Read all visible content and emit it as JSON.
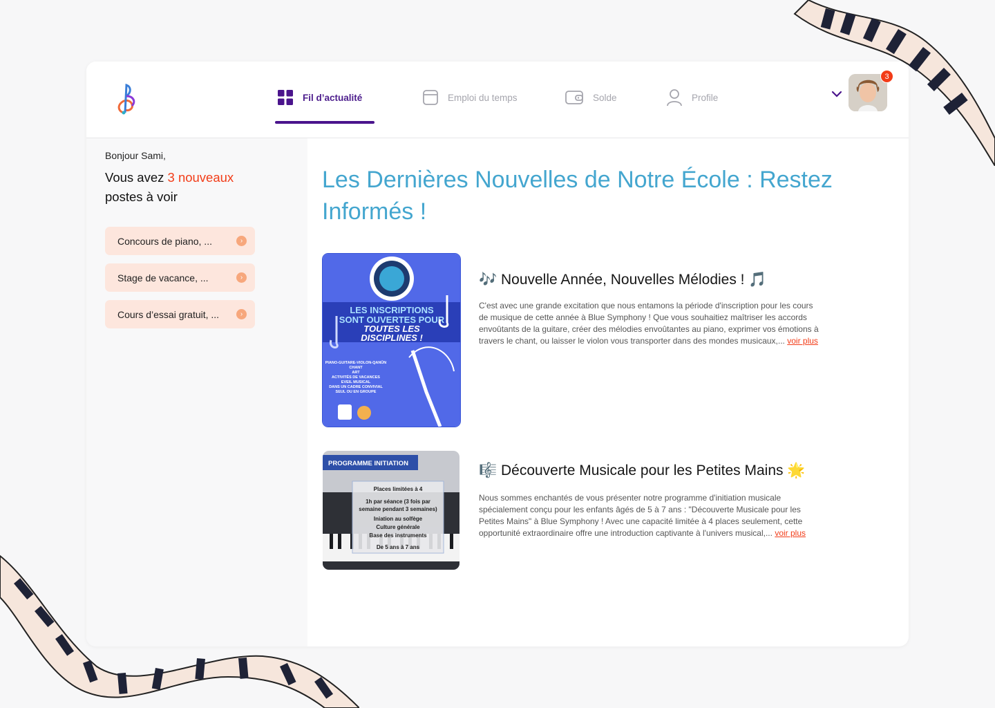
{
  "nav": {
    "items": [
      {
        "label": "Fil d’actualité",
        "icon": "grid-icon",
        "active": true
      },
      {
        "label": "Emploi du temps",
        "icon": "calendar-icon",
        "active": false
      },
      {
        "label": "Solde",
        "icon": "wallet-icon",
        "active": false
      },
      {
        "label": "Profile",
        "icon": "user-icon",
        "active": false
      }
    ]
  },
  "user": {
    "notification_count": "3"
  },
  "sidebar": {
    "greeting": "Bonjour Sami,",
    "headline_pre": "Vous avez ",
    "headline_count": "3 nouveaux",
    "headline_post": "postes à voir",
    "posts": [
      {
        "label": "Concours de piano, ..."
      },
      {
        "label": "Stage de vacance, ..."
      },
      {
        "label": "Cours d’essai gratuit, ..."
      }
    ]
  },
  "main": {
    "title": "Les Dernières Nouvelles de Notre École : Restez Informés !",
    "posts": [
      {
        "title": "🎶 Nouvelle Année, Nouvelles Mélodies ! 🎵",
        "text": "C'est avec une grande excitation que nous entamons la période d'inscription pour les cours de musique de cette année à Blue Symphony ! Que vous souhaitiez maîtriser les accords envoûtants de la guitare, créer des mélodies envoûtantes au piano, exprimer vos émotions à travers le chant, ou laisser le violon vous transporter dans des mondes musicaux,...",
        "more": "voir plus",
        "poster": {
          "heading_1": "LES INSCRIPTIONS",
          "heading_2": "SONT OUVERTES POUR",
          "heading_3": "TOUTES LES",
          "heading_4": "DISCIPLINES !",
          "lines": [
            "PIANO-GUITARE-VIOLON-QANÛN",
            "CHANT",
            "ART",
            "ACTIVITÉS DE VACANCES",
            "EVEIL MUSICAL",
            "DANS UN CADRE CONVIVIAL",
            "SEUL OU EN GROUPE"
          ]
        }
      },
      {
        "title": "🎼 Découverte Musicale pour les Petites Mains 🌟",
        "text": "Nous sommes enchantés de vous présenter notre programme d'initiation musicale spécialement conçu pour les enfants âgés de 5 à 7 ans : \"Découverte Musicale pour les Petites Mains\" à Blue Symphony ! Avec une capacité limitée à 4 places seulement, cette opportunité extraordinaire offre une introduction captivante à l'univers musical,...",
        "more": "voir plus",
        "poster": {
          "banner": "PROGRAMME INITIATION",
          "lines": [
            "Places limitées à 4",
            "1h par séance (3 fois par",
            "semaine pendant 3 semaines)",
            "Iniation au solfège",
            "Culture générale",
            "Base des instruments",
            "De 5 ans à 7 ans"
          ]
        }
      }
    ]
  },
  "colors": {
    "accent": "#4a148c",
    "highlight": "#f23c18",
    "title": "#44a6cf"
  }
}
